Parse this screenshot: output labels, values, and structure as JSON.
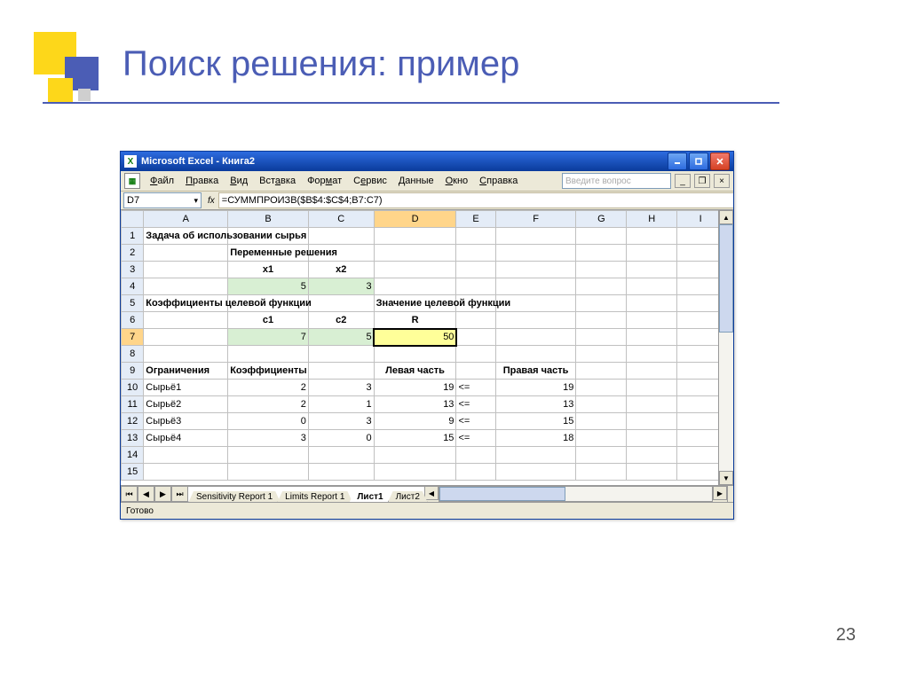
{
  "slide": {
    "title": "Поиск решения: пример",
    "page_number": "23"
  },
  "excel": {
    "titlebar": "Microsoft Excel - Книга2",
    "menu": [
      "Файл",
      "Правка",
      "Вид",
      "Вставка",
      "Формат",
      "Сервис",
      "Данные",
      "Окно",
      "Справка"
    ],
    "help_placeholder": "Введите вопрос",
    "name_box": "D7",
    "fx": "fx",
    "formula": "=СУММПРОИЗВ($B$4:$C$4;B7:C7)",
    "columns": [
      "A",
      "B",
      "C",
      "D",
      "E",
      "F",
      "G",
      "H",
      "I"
    ],
    "row_count": 15,
    "active_row": 7,
    "active_col": "D",
    "cells": {
      "1": {
        "A": "Задача об использовании сырья"
      },
      "2": {
        "B": "Переменные решения"
      },
      "3": {
        "B": "x1",
        "C": "x2"
      },
      "4": {
        "B": "5",
        "C": "3"
      },
      "5": {
        "A": "Коэффициенты целевой функции",
        "D": "Значение целевой функции"
      },
      "6": {
        "B": "c1",
        "C": "c2",
        "D": "R"
      },
      "7": {
        "B": "7",
        "C": "5",
        "D": "50"
      },
      "9": {
        "A": "Ограничения",
        "B": "Коэффициенты",
        "D": "Левая часть",
        "F": "Правая часть"
      },
      "10": {
        "A": "Сырьё1",
        "B": "2",
        "C": "3",
        "D": "19",
        "E": "<=",
        "F": "19"
      },
      "11": {
        "A": "Сырьё2",
        "B": "2",
        "C": "1",
        "D": "13",
        "E": "<=",
        "F": "13"
      },
      "12": {
        "A": "Сырьё3",
        "B": "0",
        "C": "3",
        "D": "9",
        "E": "<=",
        "F": "15"
      },
      "13": {
        "A": "Сырьё4",
        "B": "3",
        "C": "0",
        "D": "15",
        "E": "<=",
        "F": "18"
      }
    },
    "sheet_tabs": [
      "Sensitivity Report 1",
      "Limits Report 1",
      "Лист1",
      "Лист2"
    ],
    "active_tab": "Лист1",
    "status": "Готово"
  }
}
